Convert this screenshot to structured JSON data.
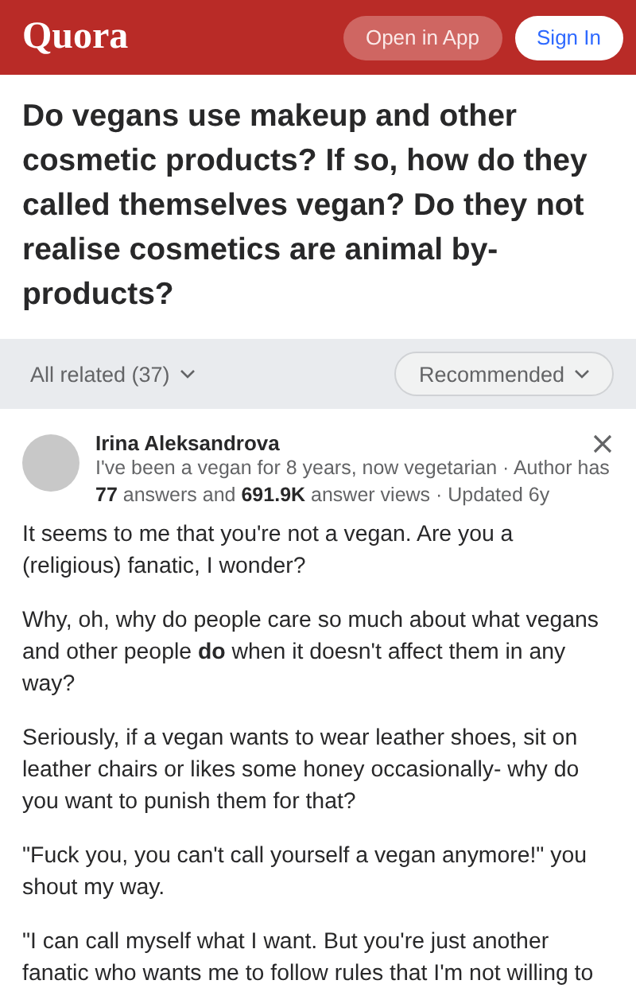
{
  "header": {
    "logo": "Quora",
    "open_app": "Open in App",
    "sign_in": "Sign In"
  },
  "question": "Do vegans use makeup and other cosmetic products? If so, how do they called themselves vegan? Do they not realise cosmetics are animal by-products?",
  "filter_bar": {
    "related": "All related (37)",
    "sort": "Recommended"
  },
  "answer": {
    "author": "Irina Aleksandrova",
    "credential": "I've been a vegan for 8 years, now vegetarian · Author has **77** answers and **691.9K** answer views · Updated 6y",
    "paragraphs": [
      "It seems to me that you're not a vegan. Are you a (religious) fanatic, I wonder?",
      "Why, oh, why do people care so much about what vegans and other people **do** when it doesn't affect them in any way?",
      "Seriously, if a vegan wants to wear leather shoes, sit on leather chairs or likes some honey occasionally- why do you want to punish them for that?",
      "\"Fuck you, you can't call yourself a vegan anymore!\" you shout my way.",
      "\"I can call myself what I want. But you're just another fanatic who wants me to follow rules that I'm not willing to"
    ]
  }
}
